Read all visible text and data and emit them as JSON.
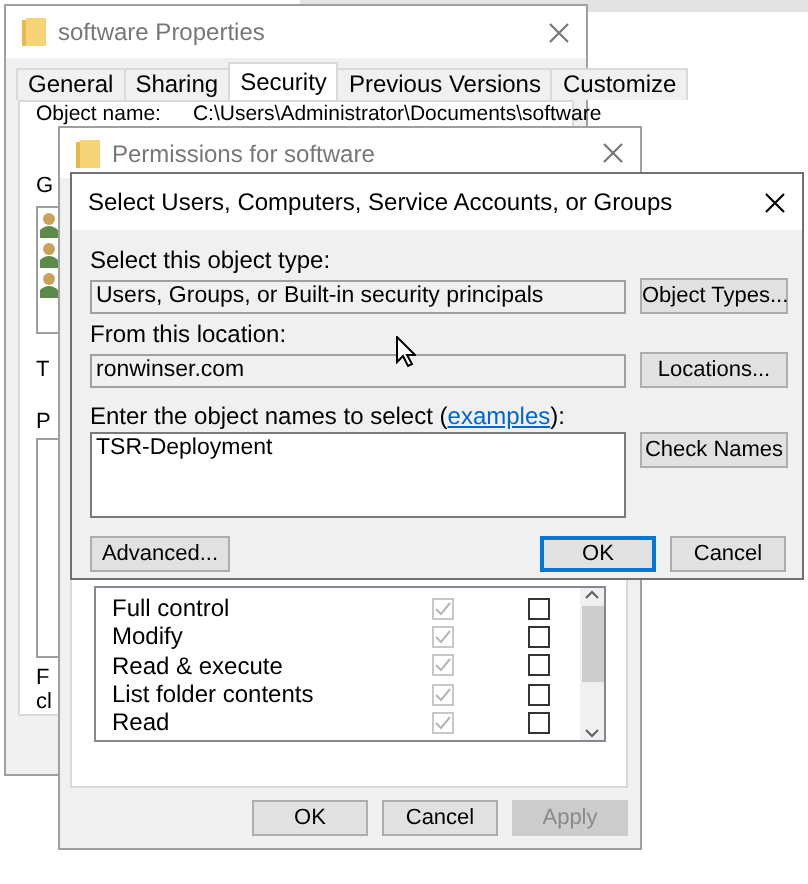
{
  "properties_window": {
    "title": "software Properties",
    "tabs": [
      {
        "label": "General",
        "selected": false
      },
      {
        "label": "Sharing",
        "selected": false
      },
      {
        "label": "Security",
        "selected": true
      },
      {
        "label": "Previous Versions",
        "selected": false
      },
      {
        "label": "Customize",
        "selected": false
      }
    ],
    "object_name_label": "Object name:",
    "object_name": "C:\\Users\\Administrator\\Documents\\software",
    "groups_label": "G",
    "to_label": "T",
    "permissions_label": "P",
    "note_lines": [
      "F",
      "cl"
    ]
  },
  "permissions_window": {
    "title": "Permissions for software",
    "permissions": [
      {
        "name": "Full control",
        "allow": true,
        "deny": false
      },
      {
        "name": "Modify",
        "allow": true,
        "deny": false
      },
      {
        "name": "Read & execute",
        "allow": true,
        "deny": false
      },
      {
        "name": "List folder contents",
        "allow": true,
        "deny": false
      },
      {
        "name": "Read",
        "allow": true,
        "deny": false
      }
    ],
    "buttons": [
      {
        "label": "OK",
        "disabled": false
      },
      {
        "label": "Cancel",
        "disabled": false
      },
      {
        "label": "Apply",
        "disabled": true
      }
    ]
  },
  "select_dialog": {
    "title": "Select Users, Computers, Service Accounts, or Groups",
    "object_type_label": "Select this object type:",
    "object_type": "Users, Groups, or Built-in security principals",
    "object_types_button": "Object Types...",
    "location_label": "From this location:",
    "location": "ronwinser.com",
    "locations_button": "Locations...",
    "names_label_before": "Enter the object names to select (",
    "names_link": "examples",
    "names_label_after": "):",
    "names": "TSR-Deployment",
    "check_names_button": "Check Names",
    "advanced_button": "Advanced...",
    "ok_button": "OK",
    "cancel_button": "Cancel"
  }
}
